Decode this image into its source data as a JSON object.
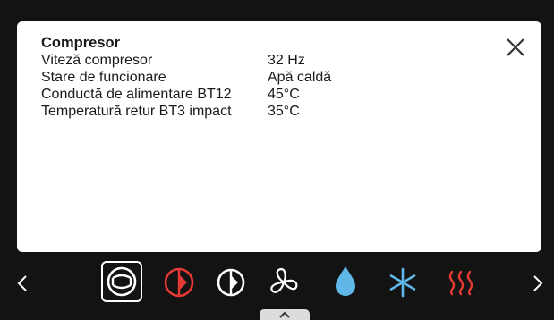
{
  "panel": {
    "title": "Compresor",
    "rows": [
      {
        "label": "Viteză compresor",
        "value": "32 Hz"
      },
      {
        "label": "Stare de funcionare",
        "value": "Apă caldă"
      },
      {
        "label": "Conductă de alimentare BT12",
        "value": "45°C"
      },
      {
        "label": "Temperatură retur BT3 impact",
        "value": "35°C"
      }
    ]
  },
  "icons": [
    {
      "name": "compressor-icon",
      "color": "#ffffff",
      "selected": true
    },
    {
      "name": "compressor-heating-icon",
      "color": "#e53935"
    },
    {
      "name": "compressor-half-icon",
      "color": "#ffffff"
    },
    {
      "name": "fan-icon",
      "color": "#ffffff"
    },
    {
      "name": "water-drop-icon",
      "color": "#5fb8e8"
    },
    {
      "name": "snowflake-icon",
      "color": "#5fb8e8"
    },
    {
      "name": "heating-waves-icon",
      "color": "#e53935"
    }
  ],
  "colors": {
    "background": "#131313",
    "panel": "#ffffff",
    "accent_red": "#e53935",
    "accent_blue": "#5fb8e8"
  }
}
